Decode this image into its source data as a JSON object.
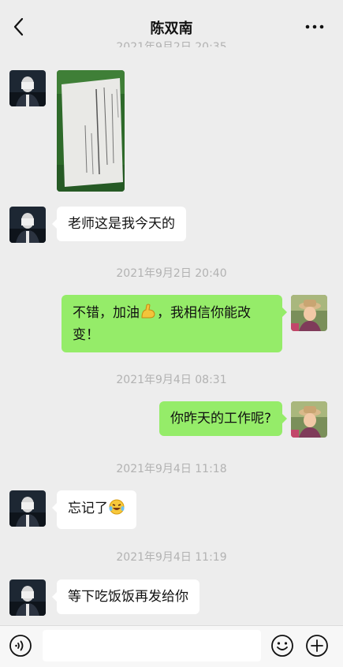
{
  "header": {
    "title": "陈双南",
    "partial_timestamp": "2021年9月2日 20:35"
  },
  "messages": {
    "m2_text": "老师这是我今天的",
    "ts1": "2021年9月2日 20:40",
    "m3_part1": "不错，加油",
    "m3_part2": "，我相信你能改变！",
    "ts2": "2021年9月4日 08:31",
    "m4_text": "你昨天的工作呢?",
    "ts3": "2021年9月4日 11:18",
    "m5_text": "忘记了",
    "ts4": "2021年9月4日 11:19",
    "m6_text": "等下吃饭饭再发给你"
  },
  "icons": {
    "back": "chevron-left-icon",
    "more": "more-dots-icon",
    "voice": "voice-icon",
    "emoji": "emoji-icon",
    "plus": "plus-icon",
    "flex": "flexed-biceps-emoji",
    "laugh": "laughing-tears-emoji"
  },
  "colors": {
    "background": "#ededed",
    "bubble_self": "#95ec69",
    "bubble_other": "#ffffff",
    "timestamp": "#b2b2b2"
  },
  "input": {
    "value": "",
    "placeholder": ""
  }
}
